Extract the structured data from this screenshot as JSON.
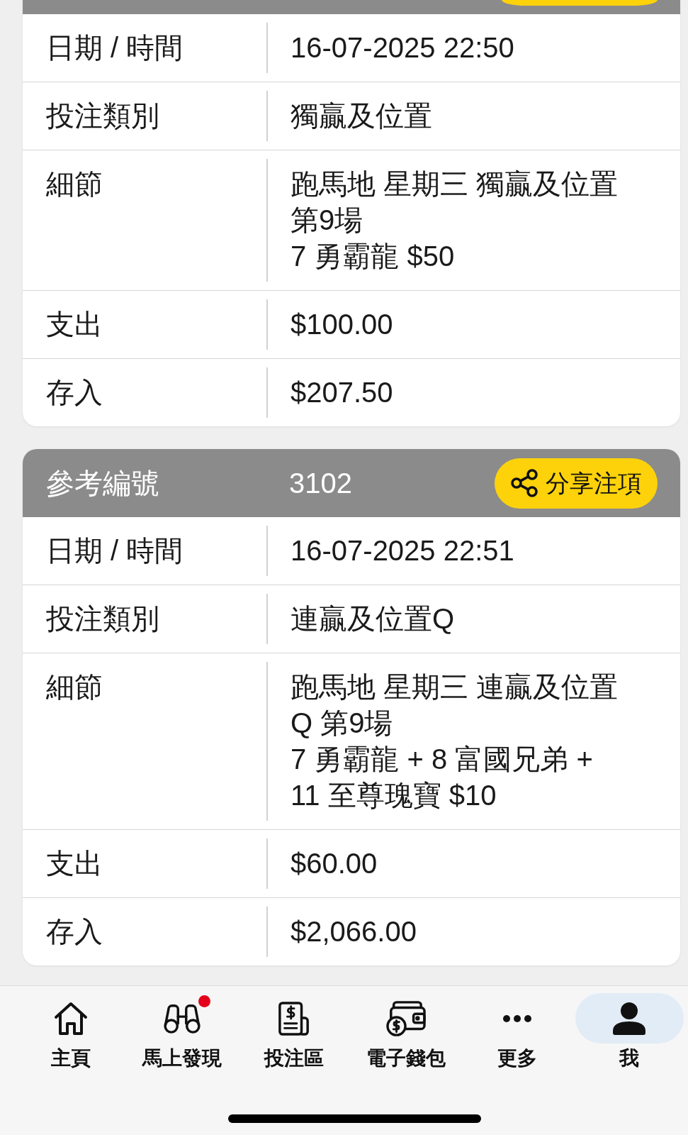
{
  "cards": [
    {
      "rows": [
        {
          "label": "日期 / 時間",
          "lines": [
            "16-07-2025 22:50"
          ]
        },
        {
          "label": "投注類別",
          "lines": [
            "獨贏及位置"
          ]
        },
        {
          "label": "細節",
          "lines": [
            "跑馬地 星期三 獨贏及位置",
            "第9場",
            "7 勇霸龍 $50"
          ]
        },
        {
          "label": "支出",
          "lines": [
            "$100.00"
          ]
        },
        {
          "label": "存入",
          "lines": [
            "$207.50"
          ]
        }
      ]
    },
    {
      "header": {
        "label": "參考編號",
        "reference": "3102",
        "share_button": "分享注項"
      },
      "rows": [
        {
          "label": "日期 / 時間",
          "lines": [
            "16-07-2025 22:51"
          ]
        },
        {
          "label": "投注類別",
          "lines": [
            "連贏及位置Q"
          ]
        },
        {
          "label": "細節",
          "lines": [
            "跑馬地 星期三 連贏及位置",
            "Q 第9場",
            "7 勇霸龍 + 8 富國兄弟 +",
            "11 至尊瑰寶 $10"
          ]
        },
        {
          "label": "支出",
          "lines": [
            "$60.00"
          ]
        },
        {
          "label": "存入",
          "lines": [
            "$2,066.00"
          ]
        }
      ]
    }
  ],
  "bottom_nav": {
    "items": [
      {
        "label": "主頁",
        "selected": false,
        "notification": false
      },
      {
        "label": "馬上發現",
        "selected": false,
        "notification": true
      },
      {
        "label": "投注區",
        "selected": false,
        "notification": false
      },
      {
        "label": "電子錢包",
        "selected": false,
        "notification": false
      },
      {
        "label": "更多",
        "selected": false,
        "notification": false
      },
      {
        "label": "我",
        "selected": true,
        "notification": false
      }
    ]
  }
}
